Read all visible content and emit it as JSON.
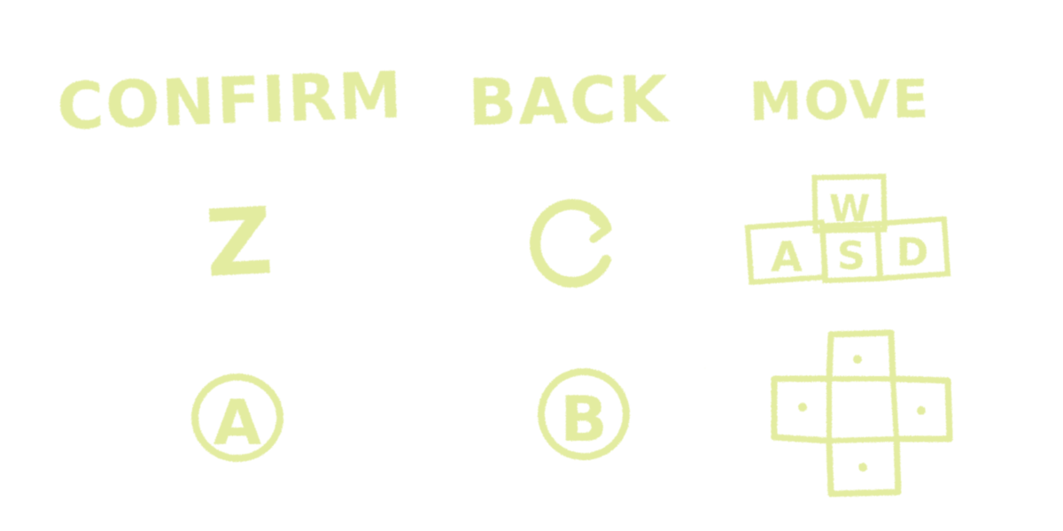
{
  "columns": [
    {
      "action": "CONFIRM"
    },
    {
      "action": "BACK"
    },
    {
      "action": "MOVE"
    }
  ],
  "keyboard": {
    "confirm_key": "Z",
    "back_key": "C",
    "move_keys": {
      "up": "W",
      "left": "A",
      "down": "S",
      "right": "D"
    }
  },
  "gamepad": {
    "confirm_button": "A",
    "back_button": "B",
    "move_control": "dpad-icon"
  },
  "icons": {
    "back_key": "circular-arrow-c-icon",
    "confirm_button": "a-button-icon",
    "back_button": "b-button-icon",
    "move_keys": "wasd-keys-icon",
    "move_control": "dpad-icon"
  },
  "colors": {
    "chalk": "#e3eca0",
    "background": "#ffffff"
  }
}
